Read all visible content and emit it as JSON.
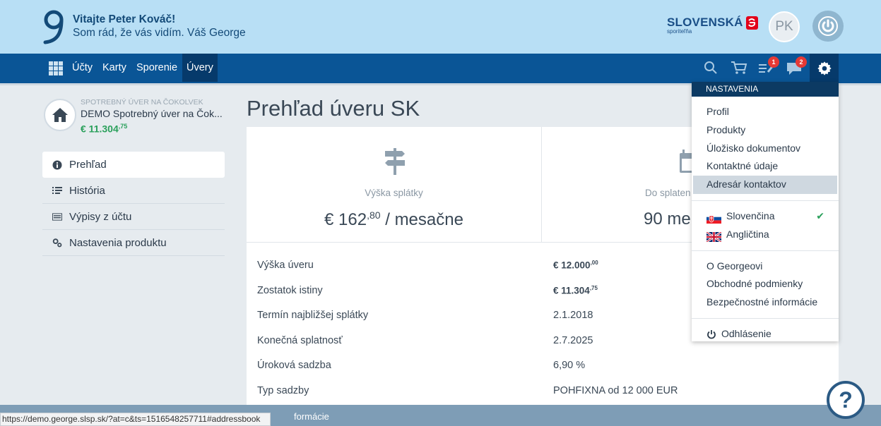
{
  "header": {
    "greeting_line1": "Vitajte Peter Kováč!",
    "greeting_line2": "Som rád, že vás vidím. Váš George",
    "bank_name": "SLOVENSKÁ",
    "bank_sub": "sporiteľňa",
    "avatar_initials": "PK"
  },
  "nav": {
    "items": [
      "Účty",
      "Karty",
      "Sporenie",
      "Úvery"
    ],
    "active": "Úvery",
    "badges": {
      "tasks": "1",
      "messages": "2"
    }
  },
  "product": {
    "category": "SPOTREBNÝ ÚVER NA ČOKOLVEK",
    "name": "DEMO Spotrebný úver na Čok...",
    "amount_main": "€ 11.304",
    "amount_cents": ",75"
  },
  "sidebar": {
    "items": [
      {
        "label": "Prehľad"
      },
      {
        "label": "História"
      },
      {
        "label": "Výpisy z účtu"
      },
      {
        "label": "Nastavenia produktu"
      }
    ]
  },
  "main": {
    "title": "Prehľad úveru SK",
    "tile1": {
      "label": "Výška splátky",
      "value_main": "€ 162",
      "value_cents": ",80",
      "value_suffix": " / mesačne"
    },
    "tile2": {
      "label": "Do splaten",
      "value": "90 me"
    },
    "rows": [
      {
        "key": "Výška úveru",
        "main": "€ 12.000",
        "cents": ",00"
      },
      {
        "key": "Zostatok istiny",
        "main": "€ 11.304",
        "cents": ",75"
      },
      {
        "key": "Termín najbližšej splátky",
        "value": "2.1.2018"
      },
      {
        "key": "Konečná splatnosť",
        "value": "2.7.2025"
      },
      {
        "key": "Úroková sadzba",
        "value": "6,90 %"
      },
      {
        "key": "Typ sadzby",
        "value": "POHFIXNA od 12 000 EUR"
      }
    ]
  },
  "dropdown": {
    "header": "NASTAVENIA",
    "group1": [
      "Profil",
      "Produkty",
      "Úložisko dokumentov",
      "Kontaktné údaje",
      "Adresár kontaktov"
    ],
    "languages": [
      "Slovenčina",
      "Angličtina"
    ],
    "group3": [
      "O Georgeovi",
      "Obchodné podmienky",
      "Bezpečnostné informácie"
    ],
    "logout": "Odhlásenie"
  },
  "footer": {
    "bar_text": "formácie",
    "status_url": "https://demo.george.slsp.sk/?at=c&ts=1516548257711#addressbook"
  },
  "colors": {
    "header_bg": "#b8dff5",
    "nav_bg": "#0a5596",
    "nav_active": "#063a6b",
    "amount_green": "#2aa05b",
    "badge_red": "#e53935"
  }
}
